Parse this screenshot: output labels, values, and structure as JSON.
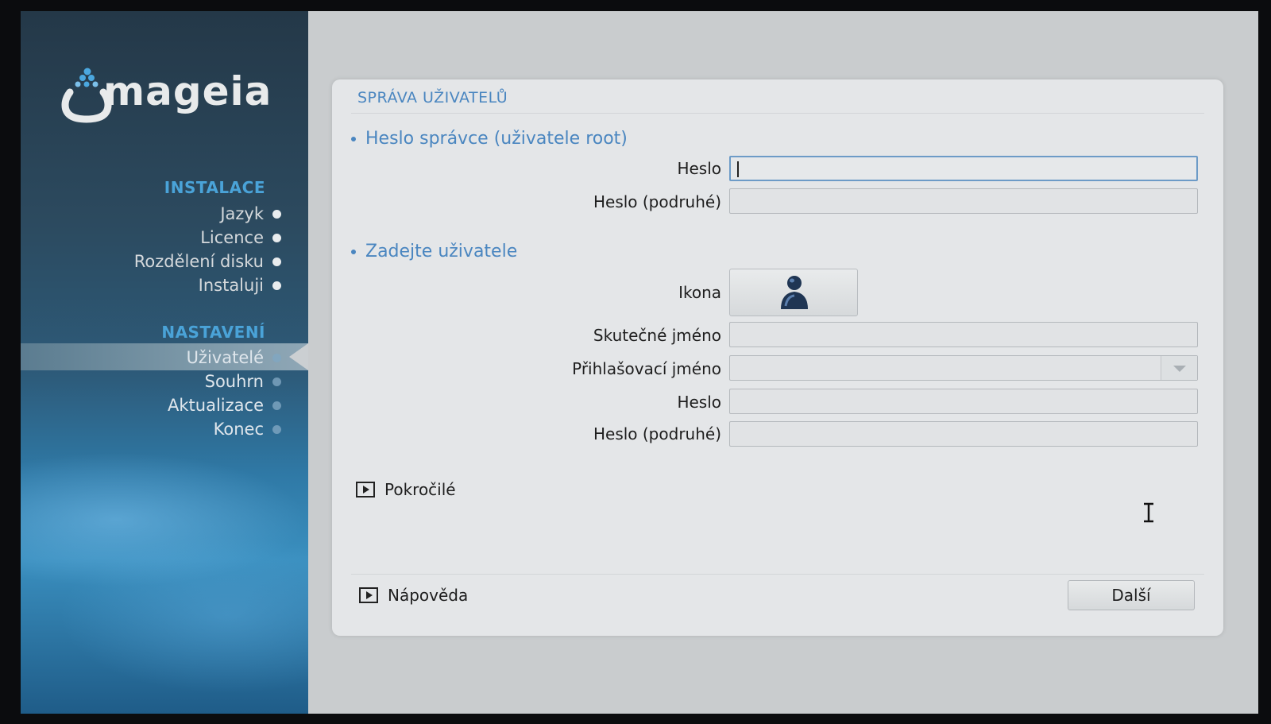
{
  "sidebar": {
    "logo_text": "mageia",
    "sections": [
      {
        "title": "INSTALACE",
        "items": [
          {
            "label": "Jazyk"
          },
          {
            "label": "Licence"
          },
          {
            "label": "Rozdělení disku"
          },
          {
            "label": "Instaluji"
          }
        ]
      },
      {
        "title": "NASTAVENÍ",
        "items": [
          {
            "label": "Uživatelé",
            "active": true
          },
          {
            "label": "Souhrn"
          },
          {
            "label": "Aktualizace"
          },
          {
            "label": "Konec"
          }
        ]
      }
    ]
  },
  "panel": {
    "title": "SPRÁVA UŽIVATELŮ",
    "root_section": {
      "heading": "Heslo správce (uživatele root)",
      "password_label": "Heslo",
      "password_value": "",
      "password_confirm_label": "Heslo (podruhé)",
      "password_confirm_value": ""
    },
    "user_section": {
      "heading": "Zadejte uživatele",
      "icon_label": "Ikona",
      "real_name_label": "Skutečné jméno",
      "real_name_value": "",
      "login_label": "Přihlašovací jméno",
      "login_value": "",
      "password_label": "Heslo",
      "password_value": "",
      "password_confirm_label": "Heslo (podruhé)",
      "password_confirm_value": ""
    },
    "advanced_label": "Pokročilé",
    "help_label": "Nápověda",
    "next_label": "Další"
  },
  "colors": {
    "accent": "#4a86c0",
    "sidebar_section": "#4aa3d8",
    "panel_bg": "#e4e6e8"
  }
}
